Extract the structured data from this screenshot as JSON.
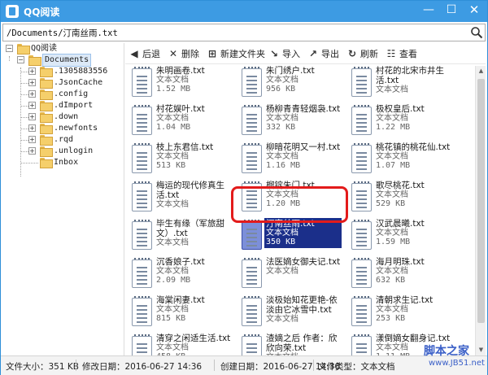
{
  "window": {
    "title": "QQ阅读",
    "colors": {
      "titlebar": "#3d9be3",
      "selection": "#1b2f8a",
      "highlight": "#e31b1b"
    }
  },
  "titlebar_buttons": {
    "minimize": "—",
    "maximize": "☐",
    "close": "✕"
  },
  "address": {
    "path": "/Documents/汀南丝雨.txt"
  },
  "tree": {
    "root": "QQ阅读",
    "documents": "Documents",
    "children": [
      ".1305883556",
      ".JsonCache",
      ".config",
      ".dImport",
      ".down",
      ".newfonts",
      ".rqd",
      ".unlogin",
      "Inbox"
    ]
  },
  "toolbar": {
    "back": "后退",
    "delete": "删除",
    "new_folder": "新建文件夹",
    "import": "导入",
    "export": "导出",
    "refresh": "刷新",
    "view": "查看"
  },
  "files": [
    {
      "name": "朱明画卷.txt",
      "type": "文本文档",
      "size": "1.52 MB"
    },
    {
      "name": "朱门绣户.txt",
      "type": "文本文档",
      "size": "956 KB"
    },
    {
      "name": "村花的北宋市井生活.txt",
      "type": "文本文档",
      "size": ""
    },
    {
      "name": "村花娱叶.txt",
      "type": "文本文档",
      "size": "1.04 MB"
    },
    {
      "name": "杨柳青青轻烟袅.txt",
      "type": "文本文档",
      "size": "332 KB"
    },
    {
      "name": "极权皇后.txt",
      "type": "文本文档",
      "size": "1.22 MB"
    },
    {
      "name": "枝上东君信.txt",
      "type": "文本文档",
      "size": "513 KB"
    },
    {
      "name": "柳暗花明又一村.txt",
      "type": "文本文档",
      "size": "1.16 MB"
    },
    {
      "name": "桃花镇的桃花仙.txt",
      "type": "文本文档",
      "size": "1.07 MB"
    },
    {
      "name": "梅运的现代修真生活.txt",
      "type": "文本文档",
      "size": ""
    },
    {
      "name": "榴锭朱门.txt",
      "type": "文本文档",
      "size": "1.20 MB"
    },
    {
      "name": "歌尽桃花.txt",
      "type": "文本文档",
      "size": "529 KB"
    },
    {
      "name": "毕生有缘（军旅甜文）.txt",
      "type": "文本文档",
      "size": ""
    },
    {
      "name": "汀南丝雨.txt",
      "type": "文本文档",
      "size": "350 KB",
      "selected": true
    },
    {
      "name": "汉武晨曦.txt",
      "type": "文本文档",
      "size": "1.59 MB"
    },
    {
      "name": "沉香娘子.txt",
      "type": "文本文档",
      "size": "2.09 MB"
    },
    {
      "name": "法医嫡女御夫记.txt",
      "type": "文本文档",
      "size": ""
    },
    {
      "name": "海月明珠.txt",
      "type": "文本文档",
      "size": "632 KB"
    },
    {
      "name": "海棠闲妻.txt",
      "type": "文本文档",
      "size": "815 KB"
    },
    {
      "name": "淡极始知花更艳-依淡由它冰雪中.txt",
      "type": "文本文档",
      "size": ""
    },
    {
      "name": "清朝求生记.txt",
      "type": "文本文档",
      "size": "253 KB"
    },
    {
      "name": "清穿之闲适生活.txt",
      "type": "文本文档",
      "size": "458 KB"
    },
    {
      "name": "渣嫡之后 作者：欣欣向荣.txt",
      "type": "文本文档",
      "size": ""
    },
    {
      "name": "漾倒嫡女翻身记.txt",
      "type": "文本文档",
      "size": "1.11 MB"
    }
  ],
  "status": {
    "size_label": "文件大小：351 KB",
    "modified_label": "修改日期：2016-06-27 14:36",
    "created_label": "创建日期：2016-06-27 14:36",
    "type_label": "文件类型：文本文档"
  },
  "watermark": {
    "title": "脚本之家",
    "sub": "www.JB51.net"
  }
}
